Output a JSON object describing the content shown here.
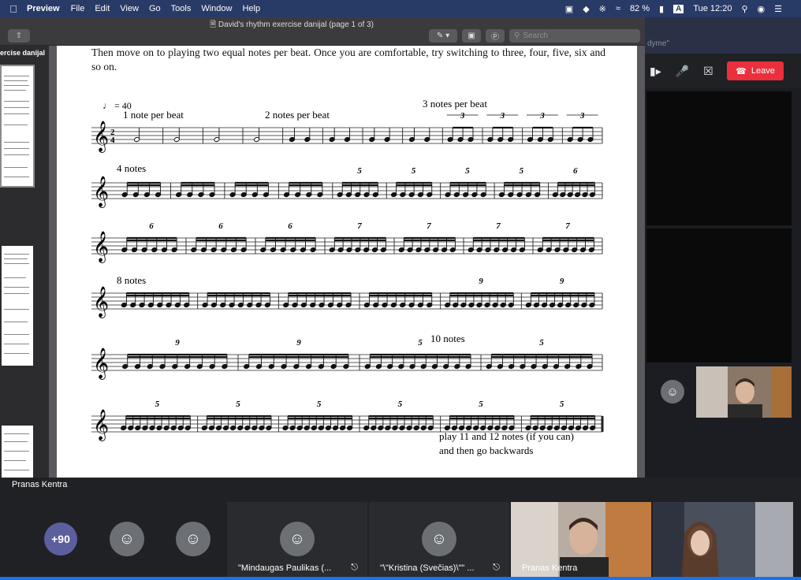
{
  "menubar": {
    "apple": "",
    "app_name": "Preview",
    "items": [
      "File",
      "Edit",
      "View",
      "Go",
      "Tools",
      "Window",
      "Help"
    ],
    "battery": "82 %",
    "input_source": "A",
    "clock": "Tue 12:20"
  },
  "preview": {
    "doc_title": "David's rhythm exercise danijal (page 1 of 3)",
    "search_placeholder": "Search",
    "sidebar_title": "ercise danijal",
    "body_text": "Then move on to playing two equal notes per beat. Once you are comfortable, try switching to three, four, five, six and so on.",
    "tempo": "♩ = 40",
    "tempo_value": "= 40",
    "staves": [
      {
        "label": "1 note per beat",
        "label2": "2 notes per beat",
        "label3": "3 notes per beat",
        "tuplets": [
          "3",
          "3",
          "3",
          "3"
        ]
      },
      {
        "label": "4 notes",
        "tuplets": [
          "5",
          "5",
          "5",
          "5",
          "6"
        ]
      },
      {
        "label": "",
        "tuplets": [
          "6",
          "6",
          "6",
          "7",
          "7",
          "7",
          "7"
        ]
      },
      {
        "label": "8 notes",
        "tuplets": [
          "9",
          "9"
        ]
      },
      {
        "label": "10 notes",
        "tuplets": [
          "9",
          "9",
          "5",
          "5"
        ]
      },
      {
        "label": "",
        "tuplets": [
          "5",
          "5",
          "5",
          "5",
          "5",
          "5"
        ]
      }
    ],
    "closing_line1": "play 11 and 12 notes (if you can)",
    "closing_line2": "and then go backwards"
  },
  "meeting": {
    "participant_hint": "dyme\"",
    "leave_label": "Leave",
    "speaker_name": "Pranas Kentra",
    "overflow_count": "+90",
    "participants": [
      {
        "name": "\"Mindaugas Paulikas (...",
        "muted": true
      },
      {
        "name": "\"\\\"Kristina (Svečias)\\\"\" ...",
        "muted": true
      },
      {
        "name": "Pranas Kentra",
        "muted": false
      }
    ]
  },
  "colors": {
    "menubar": "#283a66",
    "leave": "#ea2f3d",
    "overflow": "#5c5f9e"
  }
}
